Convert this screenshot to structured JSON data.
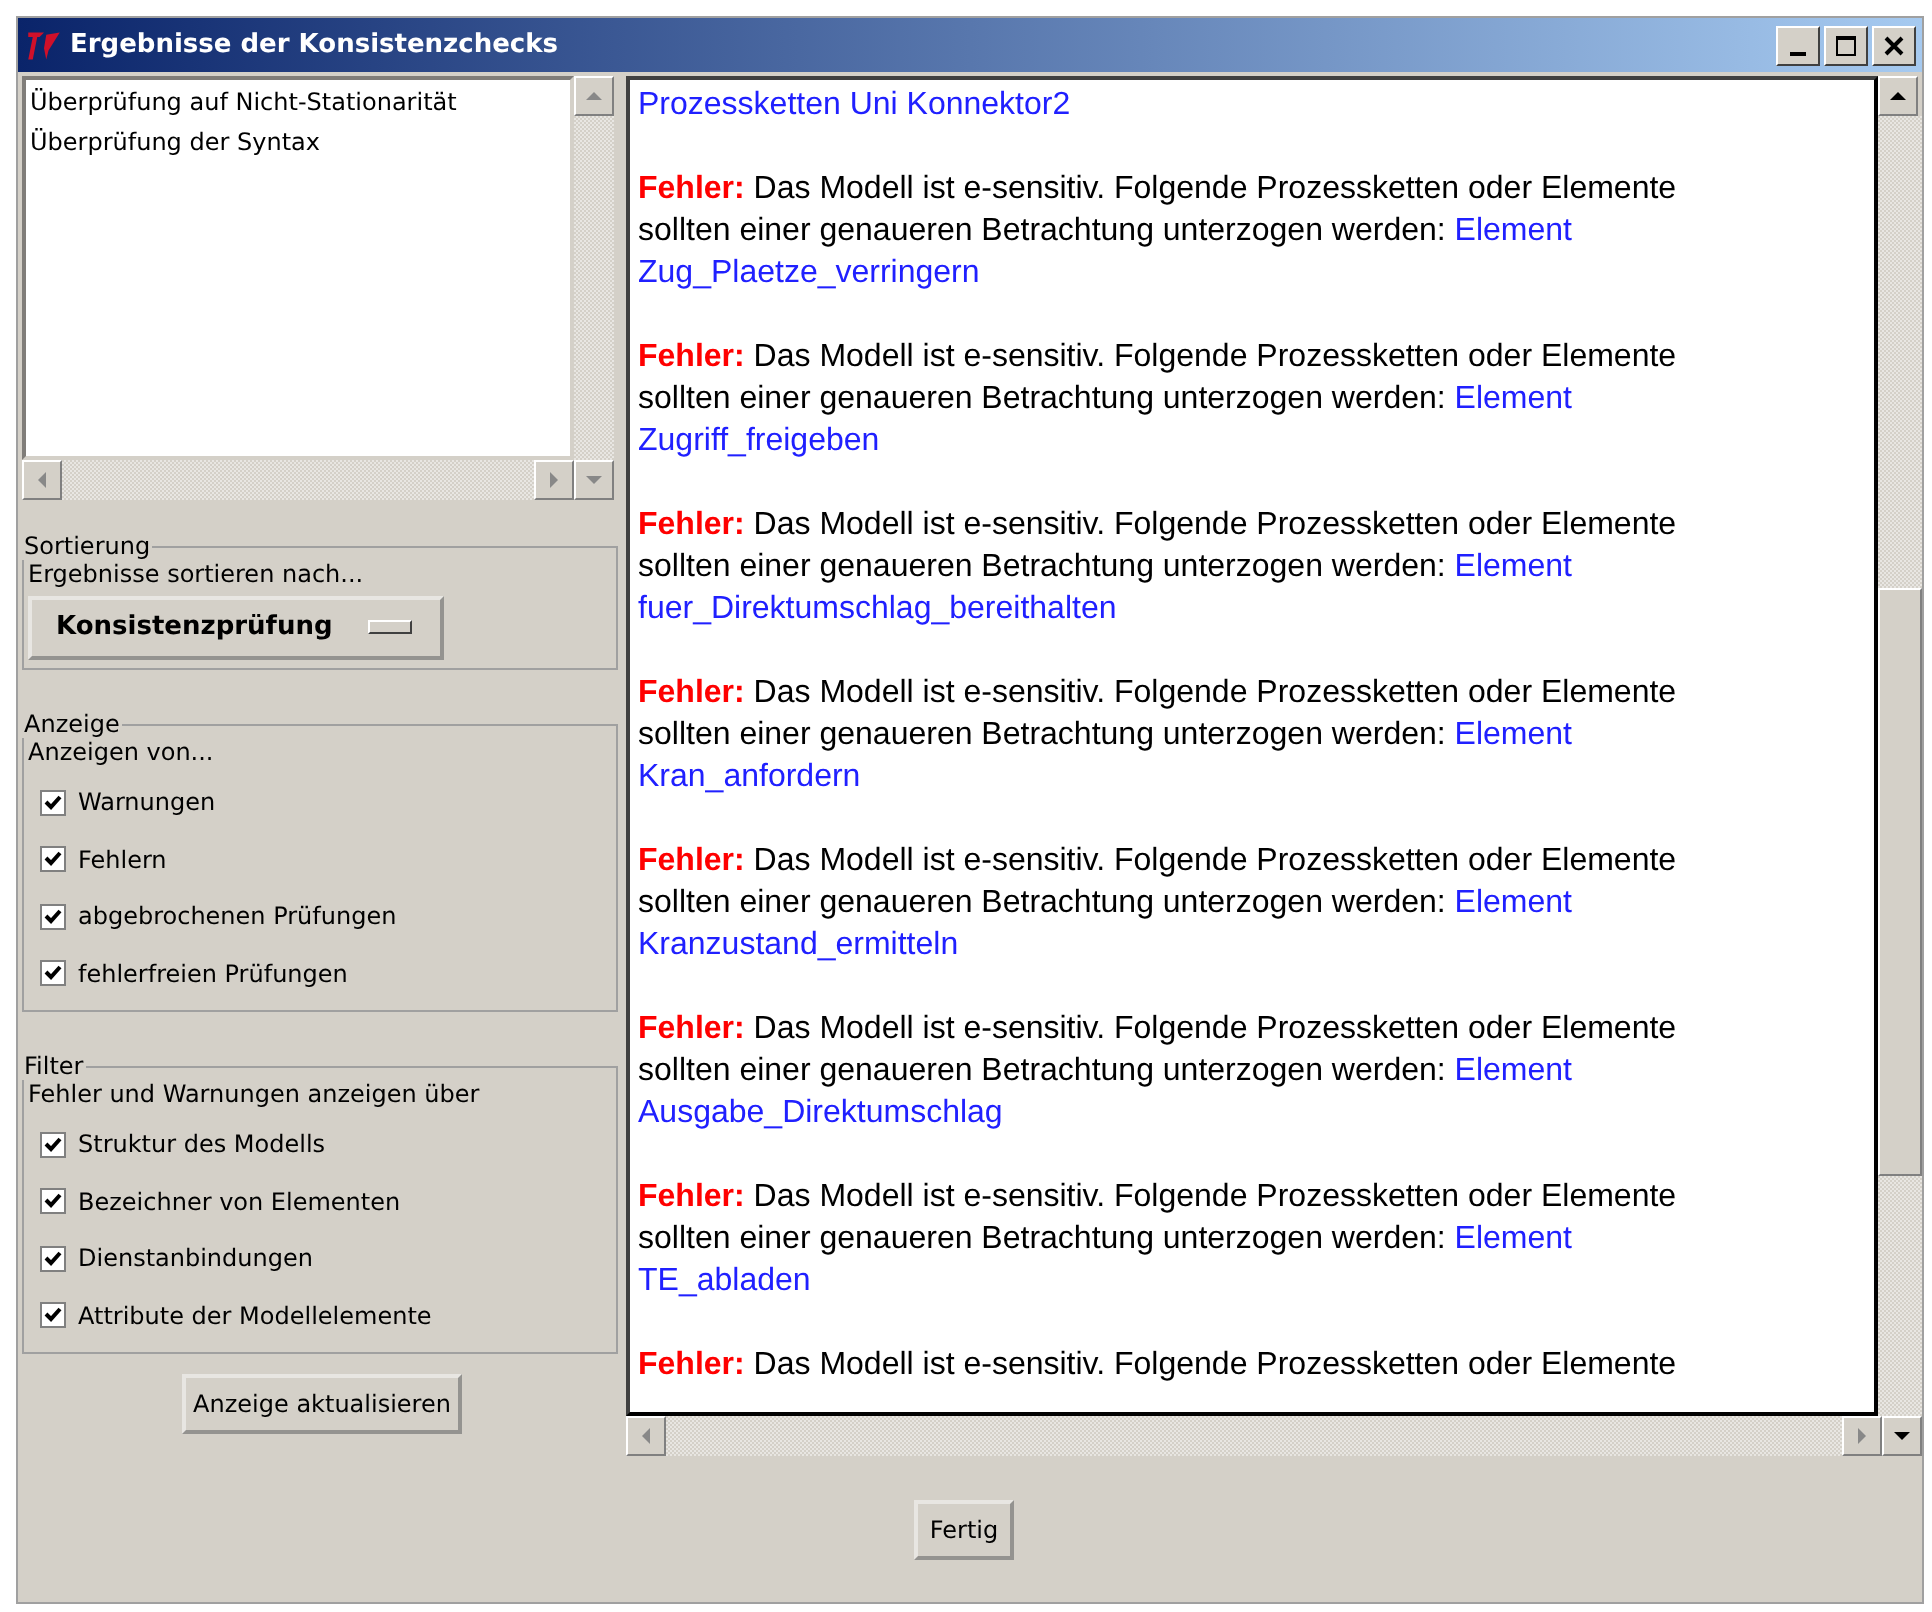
{
  "window": {
    "title": "Ergebnisse der Konsistenzchecks"
  },
  "check_list": {
    "items": [
      {
        "label": "Überprüfung auf Nicht-Stationarität"
      },
      {
        "label": "Überprüfung der Syntax"
      }
    ]
  },
  "sorting": {
    "legend": "Sortierung",
    "caption": "Ergebnisse sortieren nach...",
    "menu_value": "Konsistenzprüfung"
  },
  "display": {
    "legend": "Anzeige",
    "caption": "Anzeigen von...",
    "options": [
      {
        "label": "Warnungen",
        "checked": true
      },
      {
        "label": "Fehlern",
        "checked": true
      },
      {
        "label": "abgebrochenen Prüfungen",
        "checked": true
      },
      {
        "label": "fehlerfreien Prüfungen",
        "checked": true
      }
    ]
  },
  "filter": {
    "legend": "Filter",
    "caption": "Fehler und Warnungen anzeigen über",
    "options": [
      {
        "label": "Struktur des Modells",
        "checked": true
      },
      {
        "label": "Bezeichner von Elementen",
        "checked": true
      },
      {
        "label": "Dienstanbindungen",
        "checked": true
      },
      {
        "label": "Attribute der Modellelemente",
        "checked": true
      }
    ]
  },
  "refresh_button": "Anzeige aktualisieren",
  "results": {
    "heading": "Prozessketten Uni Konnektor2",
    "entries": [
      {
        "kind": "error",
        "label": "Fehler:",
        "message": "Das Modell ist e-sensitiv. Folgende Prozessketten oder Elemente",
        "message_cont": "sollten einer genaueren Betrachtung unterzogen werden:",
        "link_prefix": "Element",
        "element": "Zug_Plaetze_verringern"
      },
      {
        "kind": "error",
        "label": "Fehler:",
        "message": "Das Modell ist e-sensitiv. Folgende Prozessketten oder Elemente",
        "message_cont": "sollten einer genaueren Betrachtung unterzogen werden:",
        "link_prefix": "Element",
        "element": "Zugriff_freigeben"
      },
      {
        "kind": "error",
        "label": "Fehler:",
        "message": "Das Modell ist e-sensitiv. Folgende Prozessketten oder Elemente",
        "message_cont": "sollten einer genaueren Betrachtung unterzogen werden:",
        "link_prefix": "Element",
        "element": "fuer_Direktumschlag_bereithalten"
      },
      {
        "kind": "error",
        "label": "Fehler:",
        "message": "Das Modell ist e-sensitiv. Folgende Prozessketten oder Elemente",
        "message_cont": "sollten einer genaueren Betrachtung unterzogen werden:",
        "link_prefix": "Element",
        "element": "Kran_anfordern"
      },
      {
        "kind": "error",
        "label": "Fehler:",
        "message": "Das Modell ist e-sensitiv. Folgende Prozessketten oder Elemente",
        "message_cont": "sollten einer genaueren Betrachtung unterzogen werden:",
        "link_prefix": "Element",
        "element": "Kranzustand_ermitteln"
      },
      {
        "kind": "error",
        "label": "Fehler:",
        "message": "Das Modell ist e-sensitiv. Folgende Prozessketten oder Elemente",
        "message_cont": "sollten einer genaueren Betrachtung unterzogen werden:",
        "link_prefix": "Element",
        "element": "Ausgabe_Direktumschlag"
      },
      {
        "kind": "error",
        "label": "Fehler:",
        "message": "Das Modell ist e-sensitiv. Folgende Prozessketten oder Elemente",
        "message_cont": "sollten einer genaueren Betrachtung unterzogen werden:",
        "link_prefix": "Element",
        "element": "TE_abladen"
      },
      {
        "kind": "error",
        "label": "Fehler:",
        "message": "Das Modell ist e-sensitiv. Folgende Prozessketten oder Elemente"
      }
    ]
  },
  "done_button": "Fertig"
}
